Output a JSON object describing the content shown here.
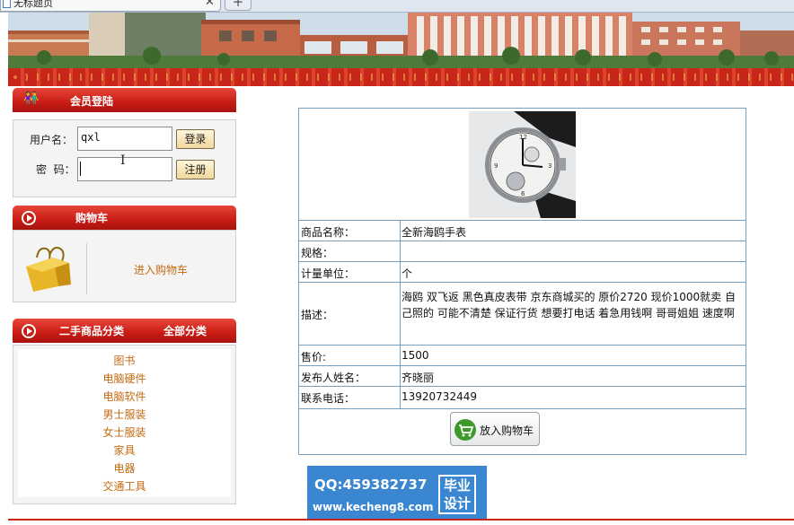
{
  "browser": {
    "tab_title": "无标题页",
    "close_glyph": "✕",
    "new_tab_glyph": "+"
  },
  "login": {
    "title": "会员登陆",
    "username_label": "用户名：",
    "username_value": "qxl",
    "password_label": "密  码：",
    "password_value": "",
    "login_button": "登录",
    "register_button": "注册"
  },
  "cart": {
    "title": "购物车",
    "link_text": "进入购物车"
  },
  "categories": {
    "title": "二手商品分类",
    "all_label": "全部分类",
    "items": [
      "图书",
      "电脑硬件",
      "电脑软件",
      "男士服装",
      "女士服装",
      "家具",
      "电器",
      "交通工具"
    ]
  },
  "product": {
    "rows": [
      {
        "key": "商品名称：",
        "value": "全新海鸥手表"
      },
      {
        "key": "规格：",
        "value": ""
      },
      {
        "key": "计量单位：",
        "value": "个"
      },
      {
        "key": "描述：",
        "value": "海鸥 双飞返 黑色真皮表带 京东商城买的 原价2720 现价1000就卖 自己照的 可能不清楚 保证行货 想要打电话 着急用钱啊 哥哥姐姐 速度啊"
      },
      {
        "key": "售价:",
        "value": "1500"
      },
      {
        "key": "发布人姓名：",
        "value": "齐晓丽"
      },
      {
        "key": "联系电话：",
        "value": "13920732449"
      }
    ],
    "buy_button": "放入购物车"
  },
  "watermark": {
    "qq": "QQ:459382737",
    "site": "www.kecheng8.com",
    "badge_line1": "毕业",
    "badge_line2": "设计"
  },
  "colors": {
    "header_red": "#c81b14",
    "link_orange": "#c46a10",
    "table_border": "#7a9fbc",
    "watermark_blue": "#3a86d0"
  }
}
